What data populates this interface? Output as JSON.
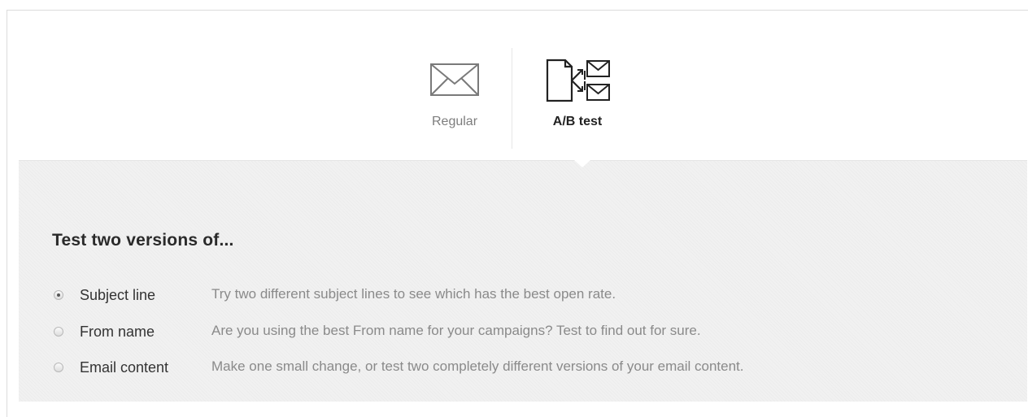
{
  "campaign_type": {
    "options": [
      {
        "label": "Regular",
        "icon": "envelope-icon",
        "selected": false
      },
      {
        "label": "A/B test",
        "icon": "ab-test-icon",
        "selected": true
      }
    ]
  },
  "ab_test": {
    "heading": "Test two versions of...",
    "options": [
      {
        "name": "Subject line",
        "description": "Try two different subject lines to see which has the best open rate.",
        "checked": true
      },
      {
        "name": "From name",
        "description": "Are you using the best From name for your campaigns? Test to find out for sure.",
        "checked": false
      },
      {
        "name": "Email content",
        "description": "Make one small change, or test two completely different versions of your email content.",
        "checked": false
      }
    ]
  },
  "colors": {
    "panel_background": "#f1f1f1",
    "selected_label": "#222222",
    "unselected_label": "#7d7d7d",
    "description_text": "#8a8a8a"
  }
}
